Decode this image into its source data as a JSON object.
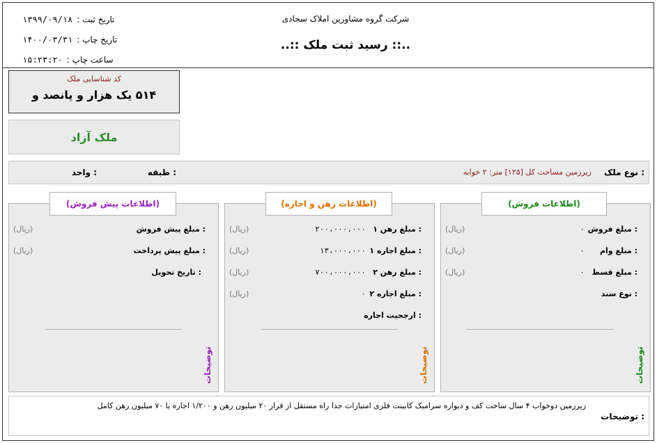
{
  "header": {
    "company": "شرکت گروه مشاورین املاک سجادی",
    "title": "..:: رسید ثبت ملک ::..",
    "meta": [
      {
        "label": "تاریخ ثبت :",
        "value": "۱۳۹۹/۰۹/۱۸"
      },
      {
        "label": "تاریخ چاپ :",
        "value": "۱۴۰۰/۰۳/۳۱"
      },
      {
        "label": "ساعت چاپ :",
        "value": "۱۵:۲۳:۲۰"
      }
    ]
  },
  "property_id": {
    "caption": "کد شناسایی ملک",
    "value": "۵۱۴ یک هزار و پانصد و"
  },
  "status": "ملک آزاد",
  "type_bar": {
    "type_label": "نوع ملک :",
    "type_desc": "زیرزمین  مساحت کل [۱۲۵] متر: ۲ خوابه",
    "floor_label": "طبقه :",
    "unit_label": "واحد :"
  },
  "colors": {
    "sale_title": "#1a8a1a",
    "rent_title": "#e07000",
    "presale_title": "#9a22c2",
    "id_caption": "#8b1a1a",
    "status_text": "#2e8b2e"
  },
  "sale": {
    "title": "(اطلاعات فروش)",
    "vertical_label": "توضیحات",
    "rows": [
      {
        "label": "مبلغ فروش :",
        "value": "۰",
        "unit": "(ریال)"
      },
      {
        "label": "مبلغ وام :",
        "value": "۰",
        "unit": "(ریال)"
      },
      {
        "label": "مبلغ قسط :",
        "value": "۰",
        "unit": "(ریال)"
      },
      {
        "label": "نوع سند :",
        "value": "",
        "unit": ""
      }
    ]
  },
  "rent": {
    "title": "(اطلاعات رهن و اجاره)",
    "vertical_label": "توضیحات",
    "rows": [
      {
        "label": "مبلغ رهن ۱ :",
        "value": "۲۰۰،۰۰۰،۰۰۰",
        "unit": "(ریال)"
      },
      {
        "label": "مبلغ اجاره ۱ :",
        "value": "۱۳،۰۰۰،۰۰۰",
        "unit": "(ریال)"
      },
      {
        "label": "مبلغ رهن ۲ :",
        "value": "۷۰۰،۰۰۰،۰۰۰",
        "unit": "(ریال)"
      },
      {
        "label": "مبلغ اجاره ۲ :",
        "value": "۰",
        "unit": "(ریال)"
      },
      {
        "label": "ارجحیت اجاره :",
        "value": "",
        "unit": ""
      }
    ]
  },
  "presale": {
    "title": "(اطلاعات پیش فروش)",
    "vertical_label": "توضیحات",
    "rows": [
      {
        "label": "مبلغ پیش فروش :",
        "value": "۰",
        "unit": "(ریال)"
      },
      {
        "label": "مبلغ پیش پرداخت :",
        "value": "۰",
        "unit": "(ریال)"
      },
      {
        "label": "تاریخ تحویل :",
        "value": "",
        "unit": ""
      }
    ]
  },
  "notes": {
    "label": "توضیحات :",
    "text": "زیرزمین دوخواب ۴ سال ساخت کف و دیواره سرامیک کابینت فلزی امتیازات جدا راه مستقل از قرار ۲۰ میلیون رهن و ۱/۲۰۰ اجاره یا ۷۰ میلیون رهن کامل"
  }
}
